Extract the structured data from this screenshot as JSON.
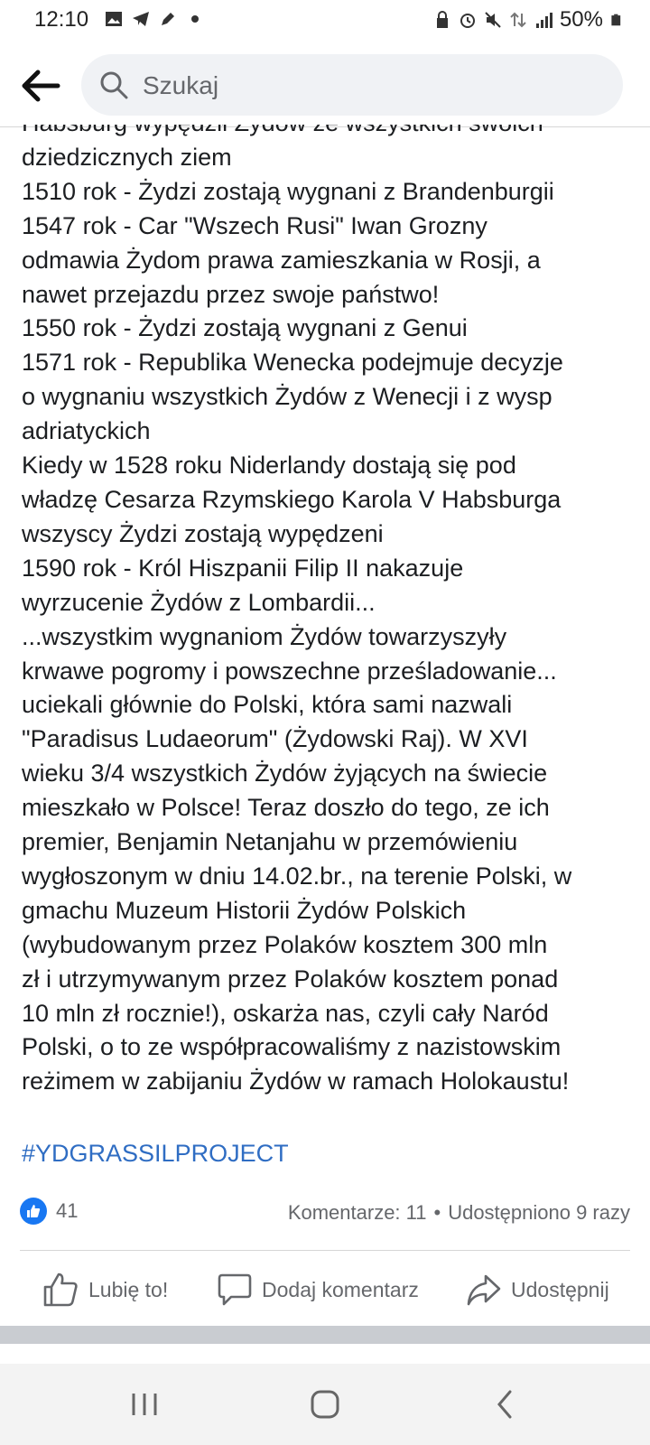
{
  "status_bar": {
    "time": "12:10",
    "battery": "50%",
    "left_icons": [
      "gallery-icon",
      "telegram-icon",
      "pen-icon",
      "dot-icon"
    ],
    "right_icons": [
      "lock-icon",
      "alarm-icon",
      "mute-icon",
      "data-icon",
      "signal-icon",
      "battery-icon"
    ]
  },
  "search": {
    "placeholder": "Szukaj"
  },
  "post": {
    "lines": [
      "Habsburg wypędził Żydów ze wszystkich swoich",
      "dziedzicznych ziem",
      "1510 rok - Żydzi zostają wygnani z Brandenburgii",
      "1547 rok - Car \"Wszech Rusi\" Iwan Grozny",
      "odmawia Żydom prawa zamieszkania w Rosji, a",
      "nawet przejazdu przez swoje państwo!",
      "1550 rok - Żydzi zostają wygnani z Genui",
      "1571 rok - Republika Wenecka podejmuje decyzje",
      "o wygnaniu wszystkich Żydów z Wenecji i z wysp",
      "adriatyckich",
      "Kiedy w 1528 roku Niderlandy dostają się pod",
      "władzę Cesarza Rzymskiego Karola V Habsburga",
      "wszyscy Żydzi zostają wypędzeni",
      "1590 rok - Król Hiszpanii Filip II nakazuje",
      "wyrzucenie Żydów z Lombardii...",
      "...wszystkim wygnaniom Żydów towarzyszyły",
      "krwawe pogromy i powszechne prześladowanie...",
      "uciekali głównie do Polski, która sami nazwali",
      "\"Paradisus Ludaeorum\" (Żydowski Raj). W XVI",
      "wieku 3/4 wszystkich Żydów żyjących na świecie",
      "mieszkało w Polsce! Teraz doszło do tego, ze ich",
      "premier, Benjamin Netanjahu w przemówieniu",
      "wygłoszonym w dniu 14.02.br., na terenie Polski, w",
      "gmachu Muzeum Historii Żydów Polskich",
      "(wybudowanym przez Polaków kosztem 300 mln",
      "zł i utrzymywanym przez Polaków kosztem ponad",
      "10 mln zł rocznie!), oskarża nas, czyli cały Naród",
      "Polski, o to ze współpracowaliśmy z nazistowskim",
      "reżimem w zabijaniu Żydów w ramach Holokaustu!"
    ],
    "hashtag": "#YDGRASSILPROJECT"
  },
  "reactions": {
    "count": "41",
    "comments": "Komentarze: 11",
    "separator": "•",
    "shares": "Udostępniono 9 razy"
  },
  "actions": {
    "like": "Lubię to!",
    "comment": "Dodaj komentarz",
    "share": "Udostępnij"
  },
  "colors": {
    "accent": "#1877f2",
    "hashtag": "#2f6dc3",
    "secondary_text": "#65676b"
  }
}
